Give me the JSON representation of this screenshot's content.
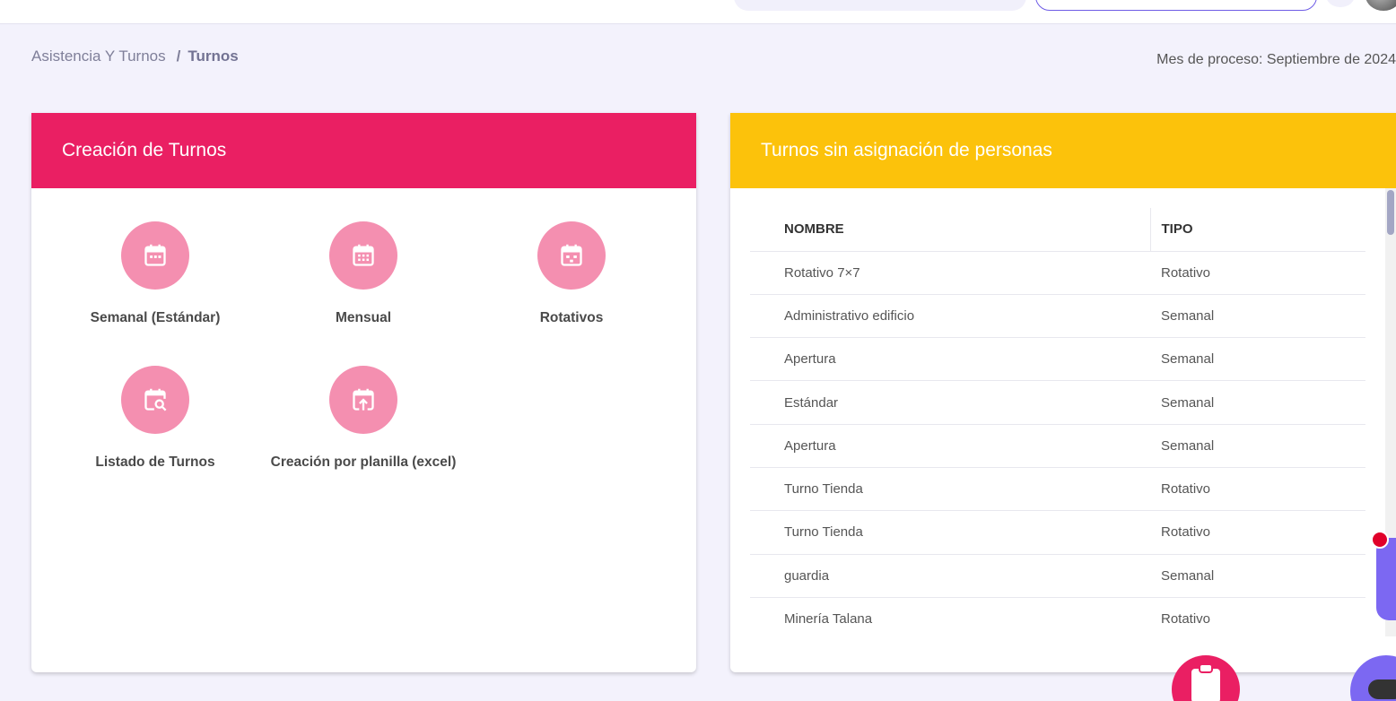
{
  "breadcrumb": {
    "parent": "Asistencia Y Turnos",
    "separator": "/",
    "current": "Turnos"
  },
  "process_month": "Mes de proceso: Septiembre de 2024",
  "creation_card": {
    "title": "Creación de Turnos",
    "tiles": [
      {
        "label": "Semanal (Estándar)",
        "icon": "calendar-week-icon"
      },
      {
        "label": "Mensual",
        "icon": "calendar-month-icon"
      },
      {
        "label": "Rotativos",
        "icon": "calendar-rotate-icon"
      },
      {
        "label": "Listado de Turnos",
        "icon": "calendar-search-icon"
      },
      {
        "label": "Creación por planilla (excel)",
        "icon": "calendar-upload-icon"
      }
    ]
  },
  "unassigned_card": {
    "title": "Turnos sin asignación de personas",
    "columns": [
      "NOMBRE",
      "TIPO"
    ],
    "rows": [
      {
        "nombre": "Rotativo 7×7",
        "tipo": "Rotativo"
      },
      {
        "nombre": "Administrativo edificio",
        "tipo": "Semanal"
      },
      {
        "nombre": "Apertura",
        "tipo": "Semanal"
      },
      {
        "nombre": "Estándar",
        "tipo": "Semanal"
      },
      {
        "nombre": "Apertura",
        "tipo": "Semanal"
      },
      {
        "nombre": "Turno Tienda",
        "tipo": "Rotativo"
      },
      {
        "nombre": "Turno Tienda",
        "tipo": "Rotativo"
      },
      {
        "nombre": "guardia",
        "tipo": "Semanal"
      },
      {
        "nombre": "Minería Talana",
        "tipo": "Rotativo"
      }
    ]
  },
  "colors": {
    "creation_header": "#ea1f63",
    "unassigned_header": "#fcc20b",
    "tile_circle": "#f48fb0",
    "accent_purple": "#7c68f2"
  }
}
